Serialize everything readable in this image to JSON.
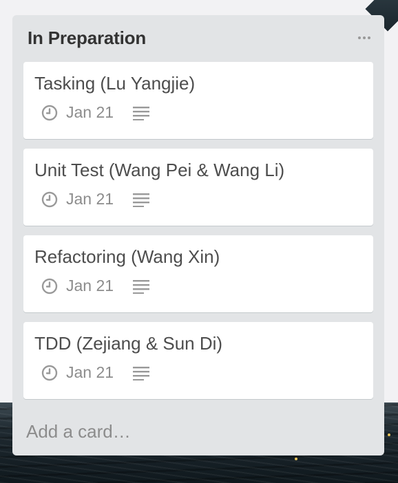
{
  "list": {
    "title": "In Preparation",
    "menu_icon": "more-horizontal-icon",
    "add_card_label": "Add a card…"
  },
  "cards": [
    {
      "title": "Tasking (Lu Yangjie)",
      "due": "Jan 21",
      "due_icon": "clock-icon",
      "has_description": true
    },
    {
      "title": "Unit Test (Wang Pei & Wang Li)",
      "due": "Jan 21",
      "due_icon": "clock-icon",
      "has_description": true
    },
    {
      "title": "Refactoring (Wang Xin)",
      "due": "Jan 21",
      "due_icon": "clock-icon",
      "has_description": true
    },
    {
      "title": "TDD (Zejiang & Sun Di)",
      "due": "Jan 21",
      "due_icon": "clock-icon",
      "has_description": true
    }
  ],
  "colors": {
    "list_bg": "#e2e4e6",
    "card_bg": "#ffffff",
    "title_text": "#333333",
    "card_text": "#4d4d4d",
    "muted_text": "#8c8c8c"
  }
}
